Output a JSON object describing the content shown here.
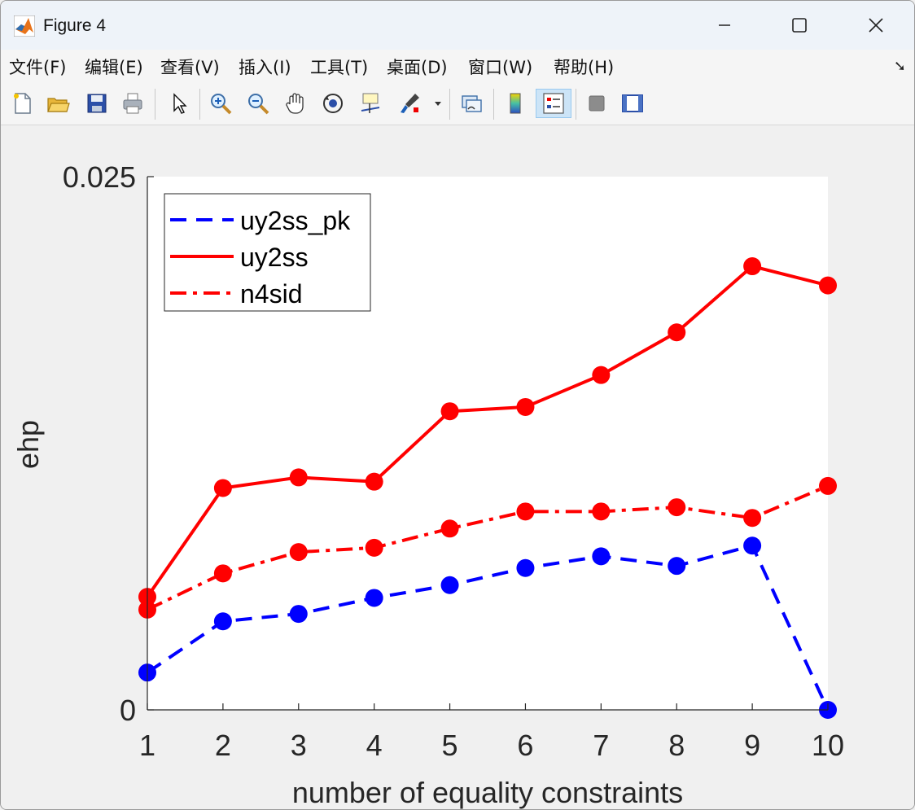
{
  "window": {
    "title": "Figure 4",
    "controls": {
      "minimize": "—",
      "maximize": "☐",
      "close": "✕"
    }
  },
  "menubar": {
    "items": [
      {
        "label": "文件(F)"
      },
      {
        "label": "编辑(E)"
      },
      {
        "label": "查看(V)"
      },
      {
        "label": "插入(I)"
      },
      {
        "label": "工具(T)"
      },
      {
        "label": "桌面(D)"
      },
      {
        "label": "窗口(W)"
      },
      {
        "label": "帮助(H)"
      }
    ],
    "overflow_icon": "dock-arrow-icon"
  },
  "toolbar": {
    "tools": [
      "new-figure-icon",
      "open-file-icon",
      "save-icon",
      "print-icon",
      "pointer-icon",
      "zoom-in-icon",
      "zoom-out-icon",
      "pan-hand-icon",
      "rotate-3d-icon",
      "data-cursor-icon",
      "brush-icon",
      "link-plot-icon",
      "colorbar-icon",
      "legend-icon",
      "hide-plot-tools-icon",
      "show-plot-tools-icon"
    ],
    "active_tool": "legend-icon"
  },
  "chart_data": {
    "type": "line",
    "xlabel": "number of equality constraints",
    "ylabel": "ehp",
    "xlim": [
      1,
      10
    ],
    "ylim": [
      0,
      0.025
    ],
    "xticks": [
      "1",
      "2",
      "3",
      "4",
      "5",
      "6",
      "7",
      "8",
      "9",
      "10"
    ],
    "yticks": [
      "0",
      "0.025"
    ],
    "grid": false,
    "legend_position": "top-left",
    "x": [
      1,
      2,
      3,
      4,
      5,
      6,
      7,
      8,
      9,
      10
    ],
    "series": [
      {
        "name": "uy2ss_pk",
        "color": "#0000ff",
        "style": "dashed",
        "values": [
          0.00175,
          0.00415,
          0.0045,
          0.00525,
          0.00585,
          0.00665,
          0.0072,
          0.00675,
          0.0077,
          0.0
        ]
      },
      {
        "name": "uy2ss",
        "color": "#ff0000",
        "style": "solid",
        "values": [
          0.0053,
          0.0104,
          0.0109,
          0.0107,
          0.014,
          0.0142,
          0.0157,
          0.0177,
          0.0208,
          0.0199
        ]
      },
      {
        "name": "n4sid",
        "color": "#ff0000",
        "style": "dashdot",
        "values": [
          0.0047,
          0.0064,
          0.0074,
          0.0076,
          0.0085,
          0.0093,
          0.0093,
          0.0095,
          0.009,
          0.0105
        ]
      }
    ]
  }
}
